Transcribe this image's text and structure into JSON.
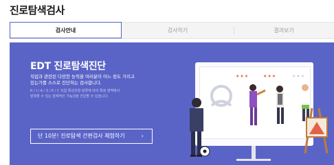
{
  "page": {
    "title": "진로탐색검사"
  },
  "tabs": [
    {
      "label": "검사안내",
      "active": true
    },
    {
      "label": "검사하기",
      "active": false
    },
    {
      "label": "결과보기",
      "active": false
    }
  ],
  "banner": {
    "title": "EDT 진로탐색진단",
    "desc_line1": "직업과 관련된 다양한 능력을 여러분이 어느 정도 가지고",
    "desc_line2": "있는가를 스스로 진단하는 검사합니다.",
    "small_line1": "R / I / A / S / E / C 직업 특성유형 분류에 따라 특정 영역에서",
    "small_line2": "발휘할 수 있는 잠재적인 가능성을 진단할 수 있습니다.",
    "cta_label": "단 10분! 진로탐색 간편검사 체험하기",
    "cta_arrow": "›",
    "background_color": "#5a64c7"
  },
  "illustration": {
    "rating_1": "★★★",
    "rating_2": "★★★",
    "rating_3": "★★★",
    "icons": [
      "profile-placeholder-icon",
      "soccer-ball-icon",
      "easel-icon"
    ]
  }
}
